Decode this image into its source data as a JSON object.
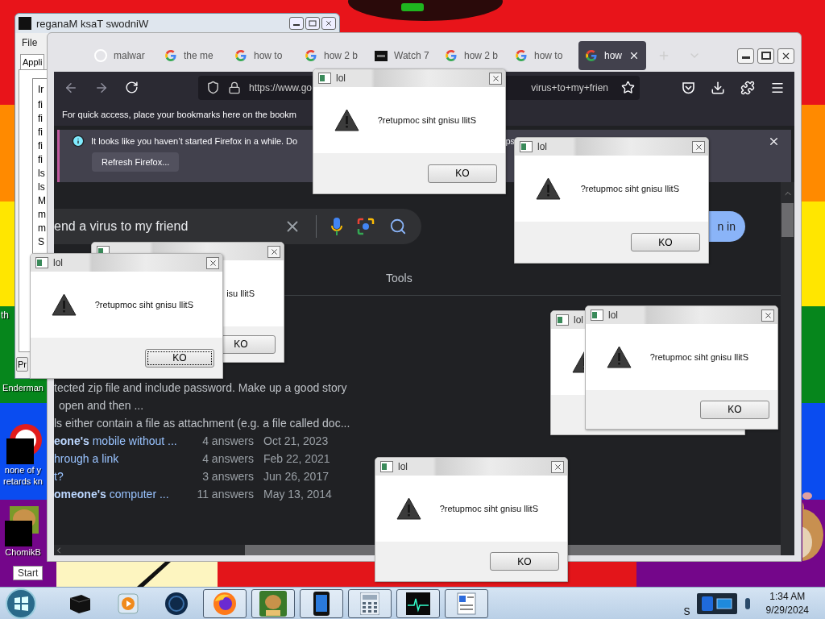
{
  "desktop": {
    "edge_text": "th",
    "icons": [
      {
        "kind": "plain",
        "lines": [
          "Enderman"
        ]
      },
      {
        "kind": "shortcut",
        "lines": [
          "none of y",
          "retards kn"
        ]
      },
      {
        "kind": "hamster",
        "lines": [
          "ChomikB"
        ]
      }
    ],
    "start_label": "Start"
  },
  "task_manager": {
    "title": "reganaM ksaT swodniW",
    "menu": [
      "File"
    ],
    "tabs": [
      {
        "label": "Appli",
        "selected": true
      }
    ],
    "column": "Ir",
    "rows": [
      "fi",
      "fi",
      "fi",
      "fi",
      "fi",
      "ls",
      "ls",
      "M",
      "m",
      "m",
      "S"
    ],
    "button": "Pr"
  },
  "browser": {
    "tabs": [
      {
        "kind": "github",
        "label": "malwar",
        "selected": false
      },
      {
        "kind": "google",
        "label": "the me",
        "selected": false
      },
      {
        "kind": "google",
        "label": "how to",
        "selected": false
      },
      {
        "kind": "google",
        "label": "how 2 b",
        "selected": false
      },
      {
        "kind": "video",
        "label": "Watch 7",
        "selected": false
      },
      {
        "kind": "google",
        "label": "how 2 b",
        "selected": false
      },
      {
        "kind": "google",
        "label": "how to",
        "selected": false
      },
      {
        "kind": "google",
        "label": "how",
        "selected": true
      }
    ],
    "url_start": "https://www.go",
    "url_end": "virus+to+my+frien",
    "bookmarks_hint": "For quick access, place your bookmarks here on the bookm",
    "notice": {
      "text": "It looks like you haven’t started Firefox in a while. Do",
      "tail": "ps",
      "button": "Refresh Firefox..."
    },
    "search": {
      "value": "end a virus to my friend"
    },
    "sign_in": "n in",
    "tools": "Tools",
    "snippets": [
      "tected zip file and include password. Make up a good story",
      "open and then ...",
      "ls either contain a file as attachment (e.g. a file called doc..."
    ],
    "questions": [
      {
        "title": "**eone's** mobile without ...",
        "answers": "4 answers",
        "date": "Oct 21, 2023"
      },
      {
        "title": "hrough a link",
        "answers": "4 answers",
        "date": "Feb 22, 2021"
      },
      {
        "title": "t?",
        "answers": "3 answers",
        "date": "Jun 26, 2017"
      },
      {
        "title": "**omeone's** computer ...",
        "answers": "11 answers",
        "date": "May 13, 2014"
      }
    ]
  },
  "dialogs": [
    {
      "message": "isu llitS",
      "button": "KO",
      "focused": false
    },
    {
      "title": "lol",
      "message": "?retupmoc siht gnisu llitS",
      "button": "KO",
      "focused": true
    },
    {
      "title": "lol",
      "message": "?retupmoc siht gnisu llitS",
      "button": "KO",
      "focused": false
    },
    {
      "title": "lol",
      "message": "?retupmoc siht gnisu llitS",
      "button": "KO",
      "focused": false
    },
    {
      "title": "lol"
    },
    {
      "title": "lol",
      "message": "?retupmoc siht gnisu llitS",
      "button": "KO",
      "focused": false
    },
    {
      "title": "lol",
      "message": "?retupmoc siht gnisu llitS",
      "button": "KO",
      "focused": false
    }
  ],
  "taskbar": {
    "apps": [
      {
        "kind": "box",
        "open": false
      },
      {
        "kind": "media",
        "open": false
      },
      {
        "kind": "globe",
        "open": false
      },
      {
        "kind": "firefox",
        "open": true
      },
      {
        "kind": "hamster",
        "open": true
      },
      {
        "kind": "tablet",
        "open": true
      },
      {
        "kind": "calculator",
        "open": true
      },
      {
        "kind": "monitor",
        "open": true
      },
      {
        "kind": "document",
        "open": true
      }
    ],
    "tray_fragment": "S",
    "time": "1:34 AM",
    "date": "9/29/2024"
  }
}
